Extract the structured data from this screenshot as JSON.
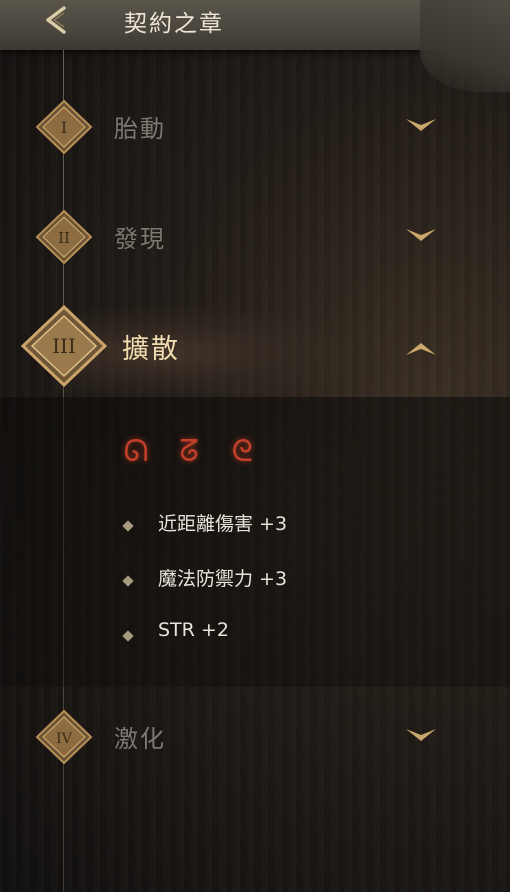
{
  "header": {
    "title": "契約之章"
  },
  "tiers": [
    {
      "numeral": "I",
      "label": "胎動",
      "expanded": false
    },
    {
      "numeral": "II",
      "label": "發現",
      "expanded": false
    },
    {
      "numeral": "III",
      "label": "擴散",
      "expanded": true
    },
    {
      "numeral": "IV",
      "label": "激化",
      "expanded": false
    }
  ],
  "expanded_tier": {
    "sigils": [
      "red-creature-sigil",
      "red-creature-sigil",
      "red-creature-sigil"
    ],
    "bonuses": [
      {
        "text": "近距離傷害 +3"
      },
      {
        "text": "魔法防禦力 +3"
      },
      {
        "text": "STR +2"
      }
    ]
  },
  "colors": {
    "accent_gold": "#c9a66b",
    "active_label": "#f1dcb0",
    "dim_label": "#7d7871",
    "sigil_red": "#c2402a"
  }
}
